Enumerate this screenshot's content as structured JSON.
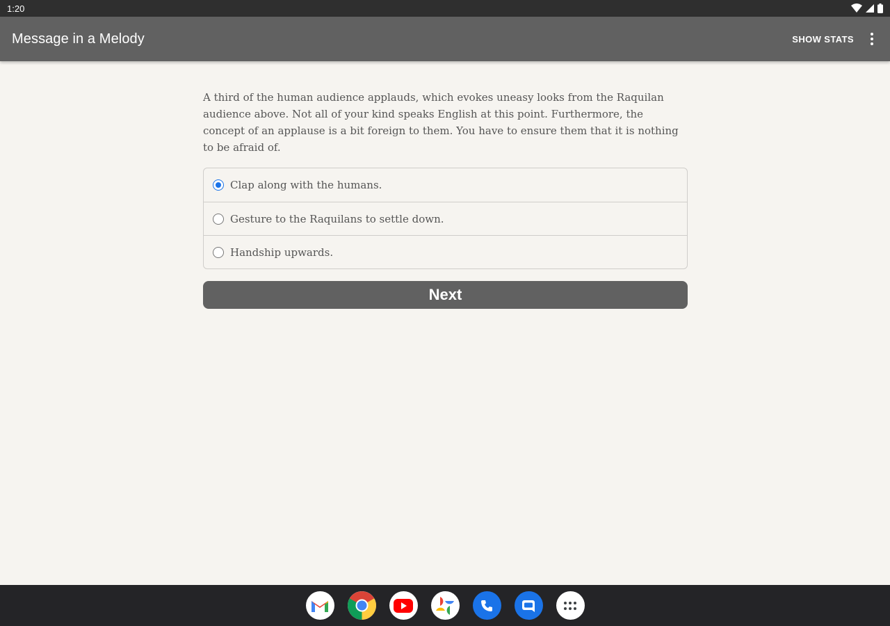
{
  "status_bar": {
    "time": "1:20",
    "icons": [
      "wifi-icon",
      "signal-icon",
      "battery-icon"
    ]
  },
  "app_bar": {
    "title": "Message in a Melody",
    "show_stats_label": "SHOW STATS",
    "overflow_icon": "more-vert-icon",
    "background": "#616161"
  },
  "story": {
    "passage": "A third of the human audience applauds, which evokes uneasy looks from the Raquilan audience above. Not all of your kind speaks English at this point. Furthermore, the concept of an applause is a bit foreign to them. You have to ensure them that it is nothing to be afraid of.",
    "choices": [
      {
        "label": "Clap along with the humans.",
        "selected": true
      },
      {
        "label": "Gesture to the Raquilans to settle down.",
        "selected": false
      },
      {
        "label": "Handship upwards.",
        "selected": false
      }
    ],
    "next_label": "Next"
  },
  "taskbar": {
    "apps": [
      "gmail-icon",
      "chrome-icon",
      "youtube-icon",
      "photos-icon",
      "phone-icon",
      "messages-icon",
      "app-drawer-icon"
    ]
  },
  "colors": {
    "accent": "#1a73e8",
    "page_background": "#f6f4f0",
    "taskbar": "#242427"
  }
}
